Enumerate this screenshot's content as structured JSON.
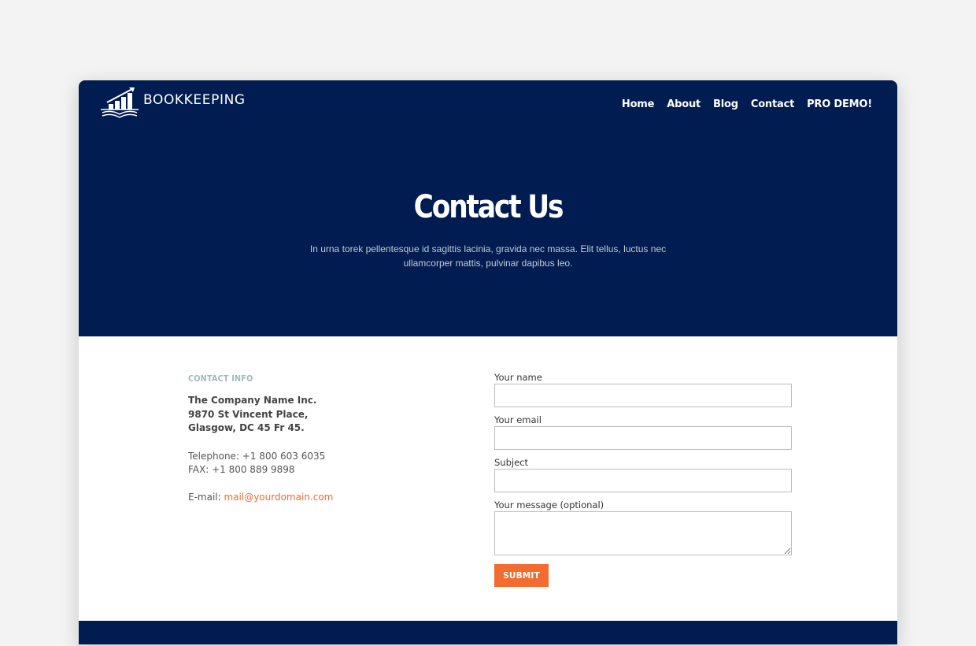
{
  "header": {
    "logo_text": "BOOKKEEPING",
    "logo_icon": "chart-book-icon",
    "nav": [
      {
        "label": "Home"
      },
      {
        "label": "About"
      },
      {
        "label": "Blog"
      },
      {
        "label": "Contact"
      },
      {
        "label": "PRO DEMO!"
      }
    ]
  },
  "hero": {
    "title": "Contact Us",
    "subtitle": "In urna torek pellentesque id sagittis lacinia, gravida nec massa. Elit tellus, luctus nec ullamcorper mattis, pulvinar dapibus leo."
  },
  "contact_info": {
    "heading": "CONTACT INFO",
    "address": [
      "The Company Name Inc.",
      "9870 St Vincent Place,",
      "Glasgow, DC 45 Fr 45."
    ],
    "telephone": "Telephone: +1 800 603 6035",
    "fax": "FAX: +1 800 889 9898",
    "email_label": "E-mail: ",
    "email": "mail@yourdomain.com"
  },
  "form": {
    "fields": [
      {
        "label": "Your name",
        "value": ""
      },
      {
        "label": "Your email",
        "value": ""
      },
      {
        "label": "Subject",
        "value": ""
      },
      {
        "label": "Your message (optional)",
        "value": ""
      }
    ],
    "submit_label": "SUBMIT"
  },
  "colors": {
    "brand_navy": "#001c50",
    "accent_orange": "#f26b2f",
    "heading_muted": "#9fb8b8"
  }
}
